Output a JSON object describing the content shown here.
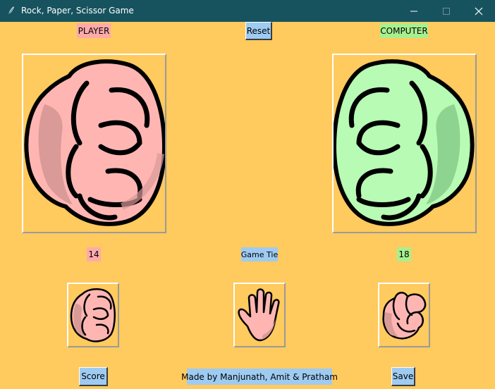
{
  "window": {
    "title": "Rock, Paper, Scissor Game"
  },
  "header": {
    "player_label": "PLAYER",
    "reset_label": "Reset",
    "computer_label": "COMPUTER"
  },
  "scores": {
    "player": "14",
    "status": "Game Tie",
    "computer": "18"
  },
  "choices": [
    {
      "name": "rock",
      "icon": "rock-hand-icon"
    },
    {
      "name": "paper",
      "icon": "paper-hand-icon"
    },
    {
      "name": "scissor",
      "icon": "scissor-hand-icon"
    }
  ],
  "footer": {
    "score_label": "Score",
    "credits": "Made by Manjunath, Amit & Pratham",
    "save_label": "Save"
  },
  "colors": {
    "background": "#ffca5e",
    "titlebar": "#17535f",
    "player_tag": "#ffaaaa",
    "computer_tag": "#a8f08e",
    "button": "#9ecbf2",
    "player_hand": "#ffb6b3",
    "computer_hand": "#b7fbb4"
  }
}
